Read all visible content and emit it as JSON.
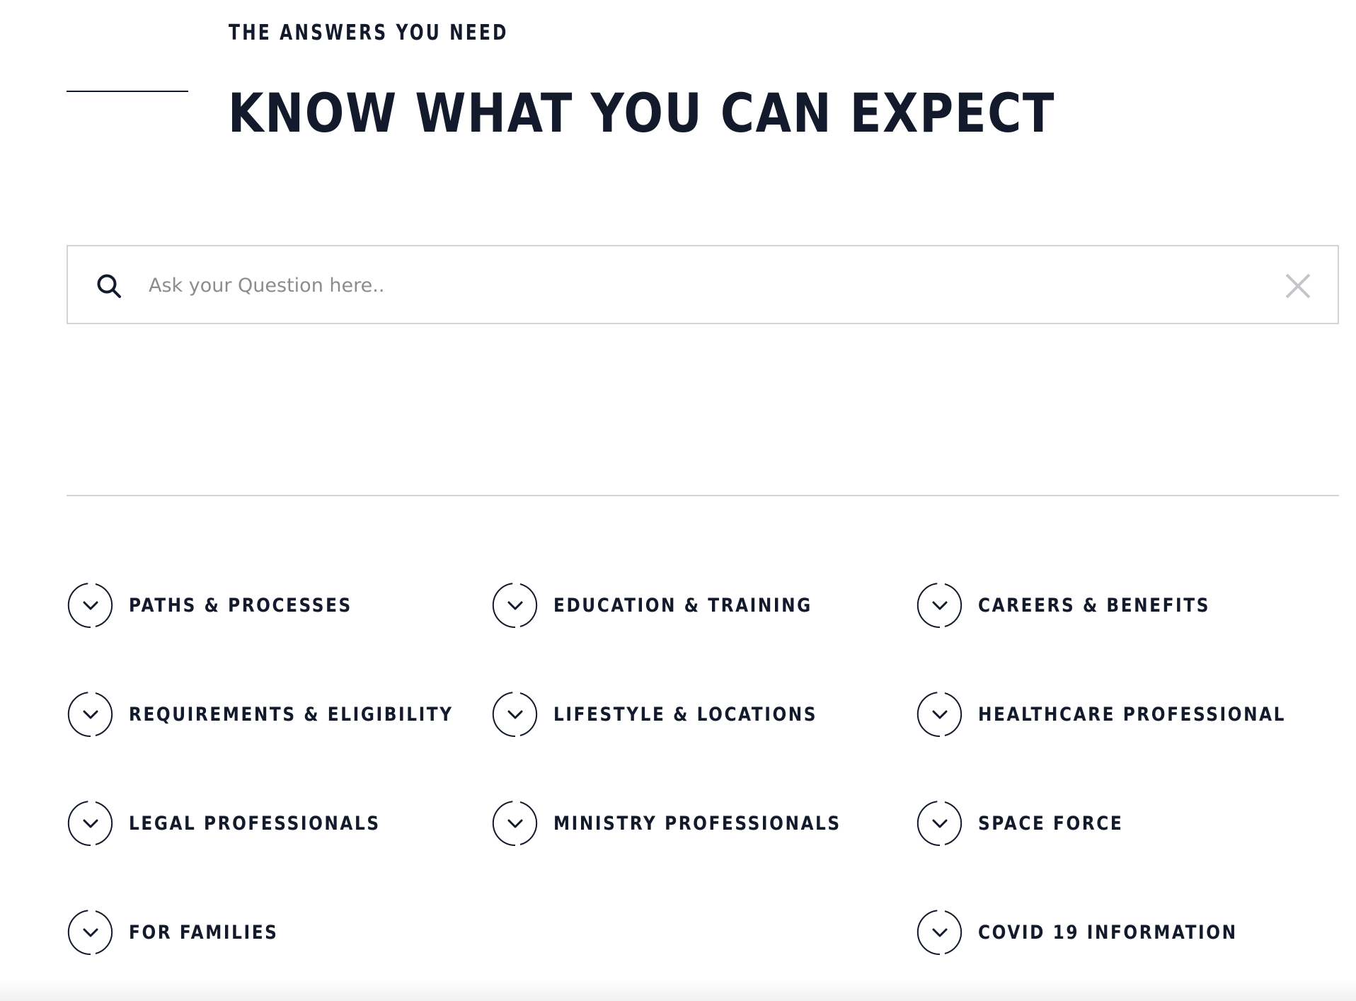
{
  "header": {
    "eyebrow": "THE ANSWERS YOU NEED",
    "title": "KNOW WHAT YOU CAN EXPECT"
  },
  "search": {
    "placeholder": "Ask your Question here..",
    "value": "",
    "icon": "search-icon",
    "clear_icon": "close-icon"
  },
  "categories": [
    {
      "label": "PATHS & PROCESSES",
      "icon": "chevron-down-icon"
    },
    {
      "label": "EDUCATION & TRAINING",
      "icon": "chevron-down-icon"
    },
    {
      "label": "CAREERS & BENEFITS",
      "icon": "chevron-down-icon"
    },
    {
      "label": "REQUIREMENTS & ELIGIBILITY",
      "icon": "chevron-down-icon"
    },
    {
      "label": "LIFESTYLE & LOCATIONS",
      "icon": "chevron-down-icon"
    },
    {
      "label": "HEALTHCARE PROFESSIONAL",
      "icon": "chevron-down-icon"
    },
    {
      "label": "LEGAL PROFESSIONALS",
      "icon": "chevron-down-icon"
    },
    {
      "label": "MINISTRY PROFESSIONALS",
      "icon": "chevron-down-icon"
    },
    {
      "label": "SPACE FORCE",
      "icon": "chevron-down-icon"
    },
    {
      "label": "FOR FAMILIES",
      "icon": "chevron-down-icon"
    },
    {
      "label": "COVID 19 INFORMATION",
      "icon": "chevron-down-icon"
    }
  ],
  "colors": {
    "text": "#121a2b",
    "border": "#d3d4d6",
    "placeholder": "#8a8c90",
    "clear_icon": "#c4c5c8",
    "background": "#ffffff"
  }
}
